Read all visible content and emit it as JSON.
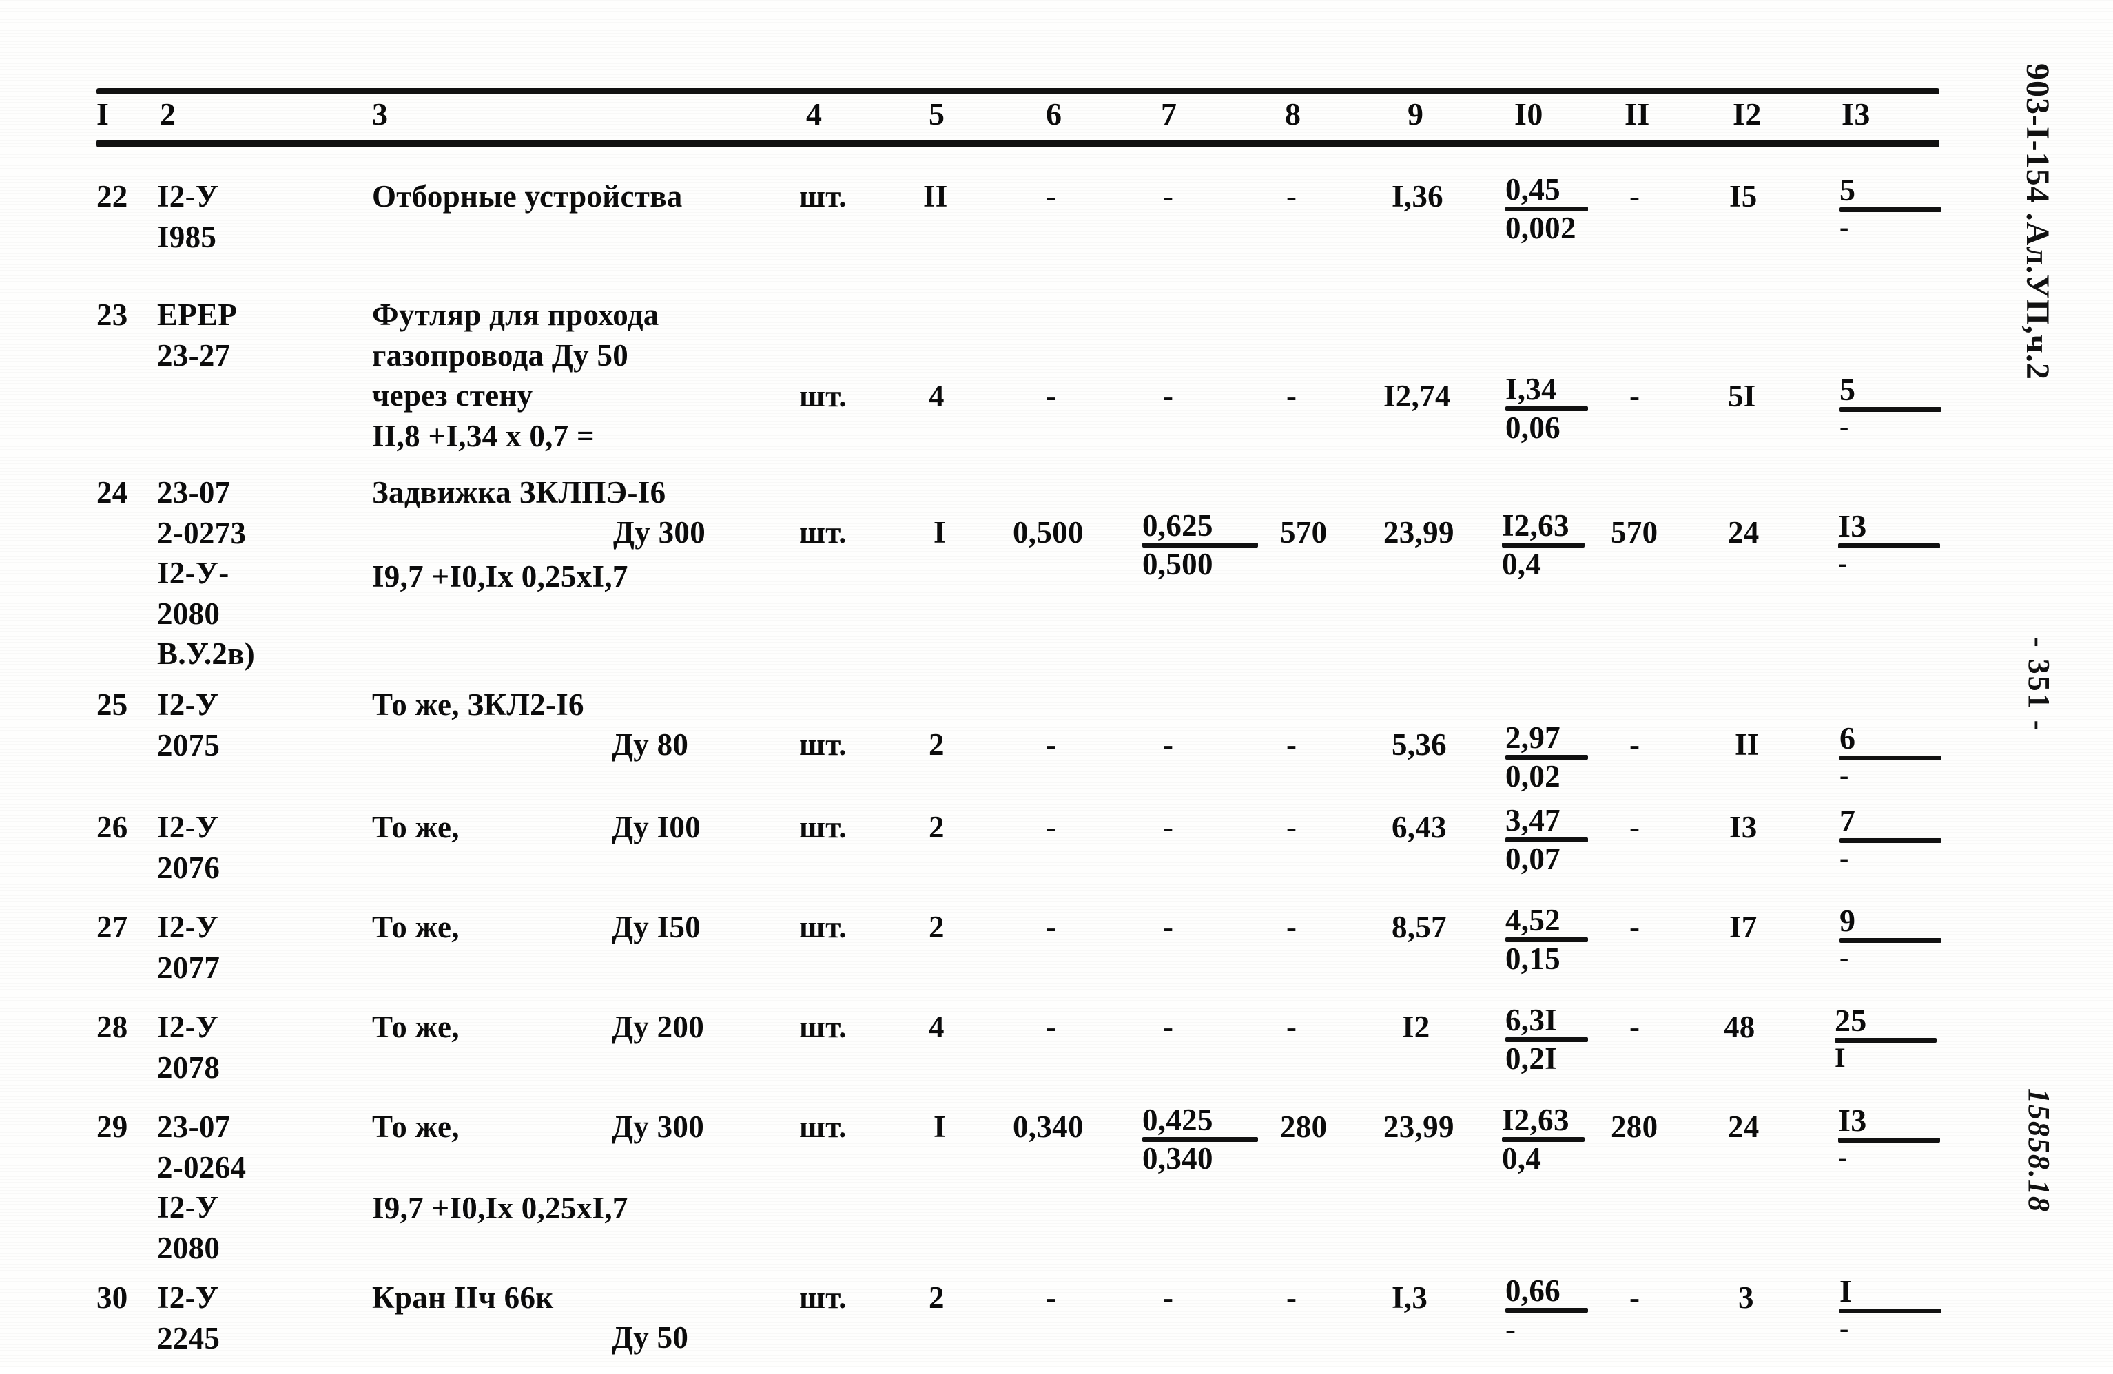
{
  "document": {
    "code": "903-I-154 .Ал.УП,ч.2",
    "page_number": "- 351 -",
    "archive_code": "15858.18"
  },
  "table": {
    "column_headers": [
      "I",
      "2",
      "3",
      "4",
      "5",
      "6",
      "7",
      "8",
      "9",
      "I0",
      "II",
      "I2",
      "I3"
    ],
    "rows": [
      {
        "num": "22",
        "code": "I2-У\nI985",
        "description": "Отборные устройства",
        "unit": "шт.",
        "qty": "II",
        "c6": "-",
        "c7_num": "-",
        "c7_den": "",
        "c8": "-",
        "c9": "I,36",
        "c10_num": "0,45",
        "c10_den": "0,002",
        "c11": "-",
        "c12": "I5",
        "c13_num": "5",
        "c13_den": "-"
      },
      {
        "num": "23",
        "code": "ЕРЕР\n23-27",
        "description": "Футляр для прохода\nгазопровода Ду 50\nчерез стену\nII,8 +I,34 х 0,7 =",
        "unit": "шт.",
        "qty": "4",
        "c6": "-",
        "c7_num": "-",
        "c7_den": "",
        "c8": "-",
        "c9": "I2,74",
        "c10_num": "I,34",
        "c10_den": "0,06",
        "c11": "-",
        "c12": "5I",
        "c13_num": "5",
        "c13_den": "-"
      },
      {
        "num": "24",
        "code": "23-07\n2-0273\nI2-У-\n2080\nВ.У.2в)",
        "description": "Задвижка ЗКЛПЭ-I6",
        "description2": "Ду 300",
        "description3": "I9,7 +I0,Iх 0,25хI,7",
        "unit": "шт.",
        "qty": "I",
        "c6": "0,500",
        "c7_num": "0,625",
        "c7_den": "0,500",
        "c8": "570",
        "c9": "23,99",
        "c10_num": "I2,63",
        "c10_den": "0,4",
        "c11": "570",
        "c12": "24",
        "c13_num": "I3",
        "c13_den": "-"
      },
      {
        "num": "25",
        "code": "I2-У\n2075",
        "description": "То же, ЗКЛ2-I6",
        "description2": "Ду 80",
        "unit": "шт.",
        "qty": "2",
        "c6": "-",
        "c7_num": "-",
        "c7_den": "",
        "c8": "-",
        "c9": "5,36",
        "c10_num": "2,97",
        "c10_den": "0,02",
        "c11": "-",
        "c12": "II",
        "c13_num": "6",
        "c13_den": "-"
      },
      {
        "num": "26",
        "code": "I2-У\n2076",
        "description": "То же,",
        "description2": "Ду I00",
        "unit": "шт.",
        "qty": "2",
        "c6": "-",
        "c7_num": "-",
        "c7_den": "",
        "c8": "-",
        "c9": "6,43",
        "c10_num": "3,47",
        "c10_den": "0,07",
        "c11": "-",
        "c12": "I3",
        "c13_num": "7",
        "c13_den": "-"
      },
      {
        "num": "27",
        "code": "I2-У\n2077",
        "description": "То же,",
        "description2": "Ду I50",
        "unit": "шт.",
        "qty": "2",
        "c6": "-",
        "c7_num": "-",
        "c7_den": "",
        "c8": "-",
        "c9": "8,57",
        "c10_num": "4,52",
        "c10_den": "0,15",
        "c11": "-",
        "c12": "I7",
        "c13_num": "9",
        "c13_den": "-"
      },
      {
        "num": "28",
        "code": "I2-У\n2078",
        "description": "То же,",
        "description2": "Ду 200",
        "unit": "шт.",
        "qty": "4",
        "c6": "-",
        "c7_num": "-",
        "c7_den": "",
        "c8": "-",
        "c9": "I2",
        "c10_num": "6,3I",
        "c10_den": "0,2I",
        "c11": "-",
        "c12": "48",
        "c13_num": "25",
        "c13_den": "I"
      },
      {
        "num": "29",
        "code": "23-07\n2-0264\nI2-У\n2080",
        "description": "То же,",
        "description2": "Ду 300",
        "description3": "I9,7 +I0,Iх 0,25хI,7",
        "unit": "шт.",
        "qty": "I",
        "c6": "0,340",
        "c7_num": "0,425",
        "c7_den": "0,340",
        "c8": "280",
        "c9": "23,99",
        "c10_num": "I2,63",
        "c10_den": "0,4",
        "c11": "280",
        "c12": "24",
        "c13_num": "I3",
        "c13_den": "-"
      },
      {
        "num": "30",
        "code": "I2-У\n2245",
        "description": "Кран IIч 66к",
        "description2": "Ду 50",
        "unit": "шт.",
        "qty": "2",
        "c6": "-",
        "c7_num": "-",
        "c7_den": "",
        "c8": "-",
        "c9": "I,3",
        "c10_num": "0,66",
        "c10_den": "-",
        "c11": "-",
        "c12": "3",
        "c13_num": "I",
        "c13_den": "-"
      }
    ]
  }
}
